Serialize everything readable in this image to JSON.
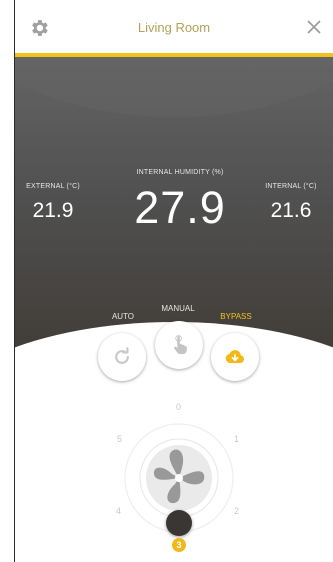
{
  "header": {
    "title": "Living Room",
    "settings_icon": "gear-icon",
    "close_icon": "close-icon"
  },
  "colors": {
    "accent": "#f2c21a",
    "title": "#b3a15a",
    "panel": "#505050"
  },
  "readings": {
    "external": {
      "label": "EXTERNAL (°C)",
      "value": "21.9"
    },
    "humidity": {
      "label": "INTERNAL HUMIDITY (%)",
      "value": "27.9"
    },
    "internal": {
      "label": "INTERNAL (°C)",
      "value": "21.6"
    }
  },
  "modes": {
    "auto": {
      "label": "AUTO",
      "icon": "refresh-icon"
    },
    "manual": {
      "label": "MANUAL",
      "icon": "hand-pointer-icon"
    },
    "bypass": {
      "label": "BYPASS",
      "icon": "cloud-download-icon",
      "active": true
    }
  },
  "fan": {
    "icon": "fan-icon",
    "speed_labels": [
      "0",
      "1",
      "2",
      "3",
      "4",
      "5"
    ],
    "current_speed": "3"
  }
}
